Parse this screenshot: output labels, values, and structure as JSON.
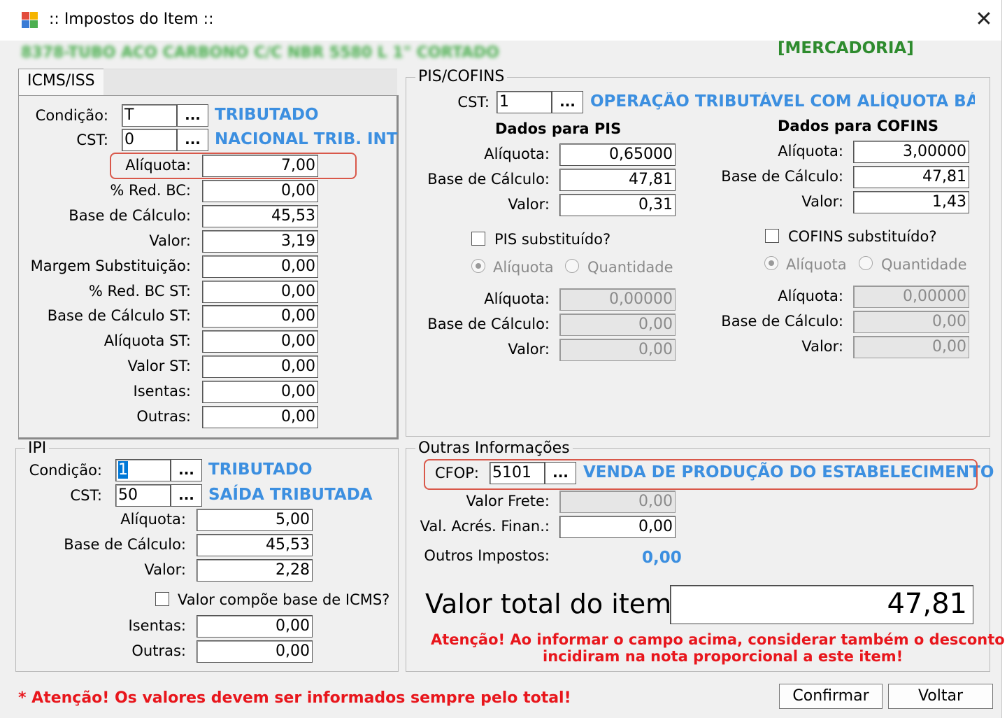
{
  "window": {
    "title": ":: Impostos do Item ::",
    "item_description": "8378-TUBO ACO CARBONO C/C NBR 5580 L 1\" CORTADO",
    "type_badge": "[MERCADORIA]"
  },
  "icms": {
    "tab_label": "ICMS/ISS",
    "condicao": {
      "label": "Condição:",
      "value": "T",
      "button": "...",
      "description": "TRIBUTADO"
    },
    "cst": {
      "label": "CST:",
      "value": "0",
      "button": "...",
      "description": "NACIONAL TRIB. INT"
    },
    "rows": [
      {
        "label": "Alíquota:",
        "value": "7,00"
      },
      {
        "label": "% Red. BC:",
        "value": "0,00"
      },
      {
        "label": "Base de Cálculo:",
        "value": "45,53"
      },
      {
        "label": "Valor:",
        "value": "3,19"
      },
      {
        "label": "Margem Substituição:",
        "value": "0,00"
      },
      {
        "label": "% Red. BC ST:",
        "value": "0,00"
      },
      {
        "label": "Base de Cálculo ST:",
        "value": "0,00"
      },
      {
        "label": "Alíquota ST:",
        "value": "0,00"
      },
      {
        "label": "Valor ST:",
        "value": "0,00"
      },
      {
        "label": "Isentas:",
        "value": "0,00"
      },
      {
        "label": "Outras:",
        "value": "0,00"
      }
    ]
  },
  "ipi": {
    "legend": "IPI",
    "condicao": {
      "label": "Condição:",
      "value": "1",
      "button": "...",
      "description": "TRIBUTADO"
    },
    "cst": {
      "label": "CST:",
      "value": "50",
      "button": "...",
      "description": "SAÍDA TRIBUTADA"
    },
    "rows": [
      {
        "label": "Alíquota:",
        "value": "5,00"
      },
      {
        "label": "Base de Cálculo:",
        "value": "45,53"
      },
      {
        "label": "Valor:",
        "value": "2,28"
      }
    ],
    "checkbox_label": "Valor compõe base de ICMS?",
    "rows2": [
      {
        "label": "Isentas:",
        "value": "0,00"
      },
      {
        "label": "Outras:",
        "value": "0,00"
      }
    ]
  },
  "piscofins": {
    "legend": "PIS/COFINS",
    "cst": {
      "label": "CST:",
      "value": "1",
      "button": "...",
      "description": "OPERAÇÃO TRIBUTÁVEL COM ALÍQUOTA BÁSICA"
    },
    "pis": {
      "heading": "Dados para PIS",
      "rows": [
        {
          "label": "Alíquota:",
          "value": "0,65000"
        },
        {
          "label": "Base de Cálculo:",
          "value": "47,81"
        },
        {
          "label": "Valor:",
          "value": "0,31"
        }
      ],
      "checkbox_label": "PIS substituído?",
      "radio_aliquota": "Alíquota",
      "radio_quantidade": "Quantidade",
      "sub_rows": [
        {
          "label": "Alíquota:",
          "value": "0,00000"
        },
        {
          "label": "Base de Cálculo:",
          "value": "0,00"
        },
        {
          "label": "Valor:",
          "value": "0,00"
        }
      ]
    },
    "cofins": {
      "heading": "Dados para COFINS",
      "rows": [
        {
          "label": "Alíquota:",
          "value": "3,00000"
        },
        {
          "label": "Base de Cálculo:",
          "value": "47,81"
        },
        {
          "label": "Valor:",
          "value": "1,43"
        }
      ],
      "checkbox_label": "COFINS substituído?",
      "radio_aliquota": "Alíquota",
      "radio_quantidade": "Quantidade",
      "sub_rows": [
        {
          "label": "Alíquota:",
          "value": "0,00000"
        },
        {
          "label": "Base de Cálculo:",
          "value": "0,00"
        },
        {
          "label": "Valor:",
          "value": "0,00"
        }
      ]
    }
  },
  "outras": {
    "legend": "Outras Informações",
    "cfop": {
      "label": "CFOP:",
      "value": "5101",
      "button": "...",
      "description": "VENDA DE PRODUÇÃO DO ESTABELECIMENTO"
    },
    "valor_frete": {
      "label": "Valor Frete:",
      "value": "0,00"
    },
    "acres_finan": {
      "label": "Val. Acrés. Finan.:",
      "value": "0,00"
    },
    "outros_impostos": {
      "label": "Outros Impostos:",
      "value": "0,00"
    },
    "total_label": "Valor total do item:",
    "total_value": "47,81",
    "warning_line1": "Atenção! Ao informar o campo acima, considerar também o desconto que",
    "warning_line2": "incidiram na nota proporcional a este item!"
  },
  "footer": {
    "warning": "* Atenção! Os valores devem ser informados sempre pelo total!",
    "confirm_label": "Confirmar",
    "back_label": "Voltar"
  },
  "colors": {
    "accent_blue": "#3c8fe0",
    "badge_green": "#2e8b2e",
    "warning_red": "#e8161c",
    "highlight_box": "#d9584a"
  }
}
